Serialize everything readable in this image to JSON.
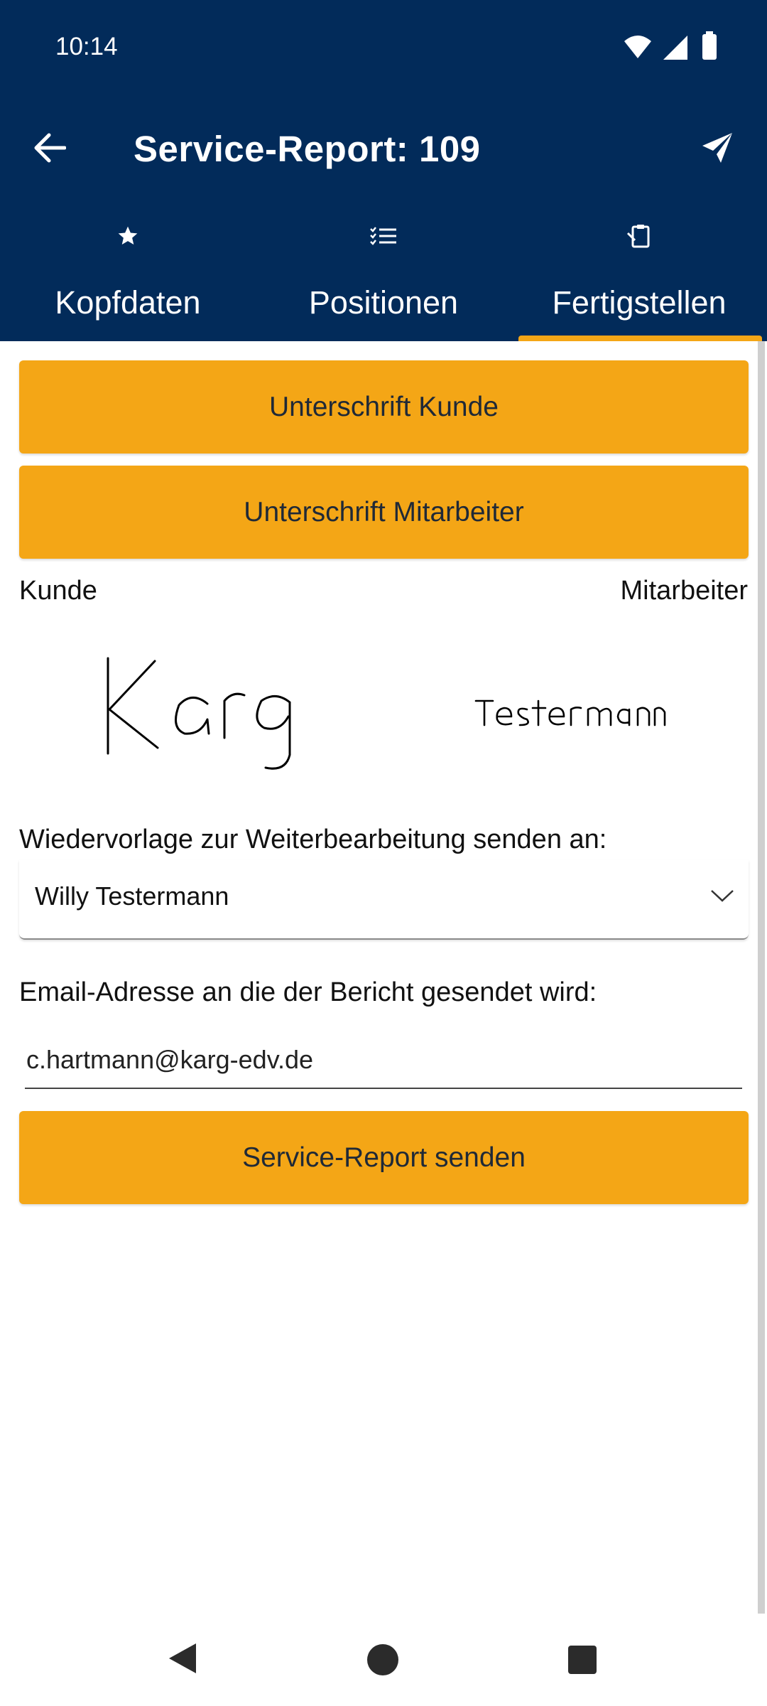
{
  "status_bar": {
    "time": "10:14",
    "icons": [
      "wifi-icon",
      "signal-icon",
      "battery-icon"
    ]
  },
  "toolbar": {
    "title": "Service-Report: 109",
    "back_icon": "arrow-left-icon",
    "send_icon": "paper-plane-icon"
  },
  "tabs": [
    {
      "label": "Kopfdaten",
      "icon": "star-icon",
      "selected": false
    },
    {
      "label": "Positionen",
      "icon": "checklist-icon",
      "selected": false
    },
    {
      "label": "Fertigstellen",
      "icon": "clipboard-sign-icon",
      "selected": true
    }
  ],
  "main": {
    "sign_customer_button": "Unterschrift Kunde",
    "sign_employee_button": "Unterschrift Mitarbeiter",
    "customer_label": "Kunde",
    "employee_label": "Mitarbeiter",
    "customer_signature": "Karg",
    "employee_signature": "Testermann",
    "forward_label": "Wiedervorlage zur Weiterbearbeitung senden an:",
    "forward_value": "Willy Testermann",
    "email_label": "Email-Adresse an die der Bericht gesendet wird:",
    "email_value": "c.hartmann@karg-edv.de",
    "send_button": "Service-Report senden"
  },
  "colors": {
    "header": "#022b5a",
    "accent": "#f4a616"
  }
}
